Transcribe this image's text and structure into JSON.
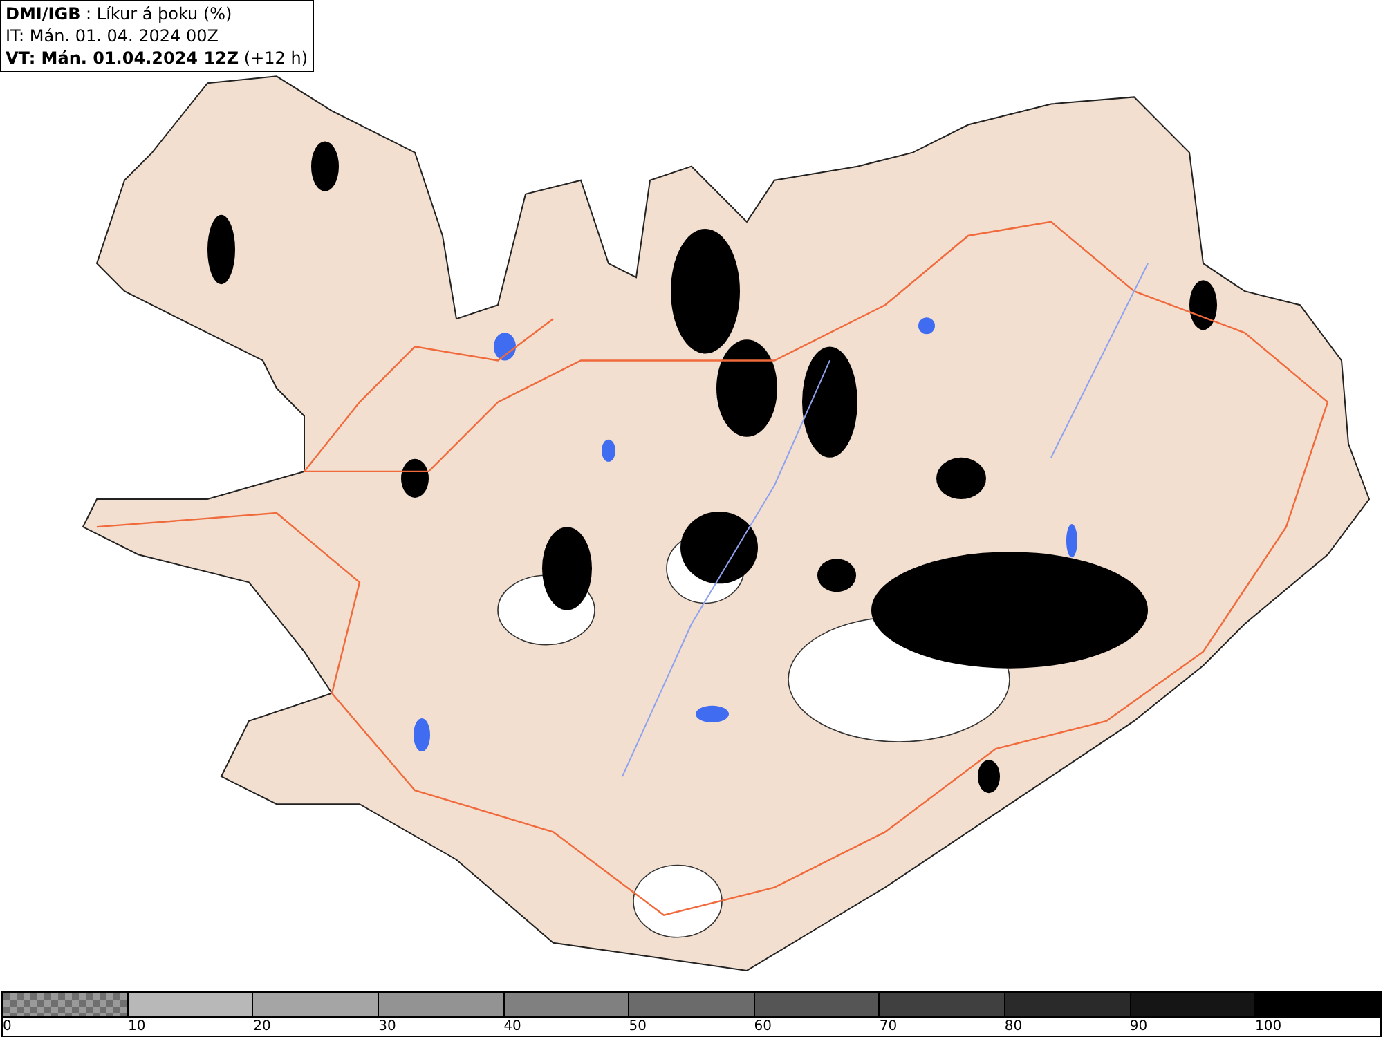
{
  "header": {
    "lines": [
      "**DMI/IGB** : Líkur á þoku (%)",
      "IT: Mán. 01. 04. 2024 00Z",
      "**VT: Mán. 01.04.2024 12Z** (+12 h)"
    ]
  },
  "legend": {
    "swatches": [
      {
        "kind": "checker"
      },
      {
        "kind": "solid",
        "color": "#b8b8b8"
      },
      {
        "kind": "solid",
        "color": "#a5a5a5"
      },
      {
        "kind": "solid",
        "color": "#939393"
      },
      {
        "kind": "solid",
        "color": "#808080"
      },
      {
        "kind": "solid",
        "color": "#6b6b6b"
      },
      {
        "kind": "solid",
        "color": "#555555"
      },
      {
        "kind": "solid",
        "color": "#404040"
      },
      {
        "kind": "solid",
        "color": "#2a2a2a"
      },
      {
        "kind": "solid",
        "color": "#151515"
      },
      {
        "kind": "solid",
        "color": "#000000"
      }
    ],
    "labels": [
      "0",
      "10",
      "20",
      "30",
      "40",
      "50",
      "60",
      "70",
      "80",
      "90",
      "100"
    ]
  }
}
